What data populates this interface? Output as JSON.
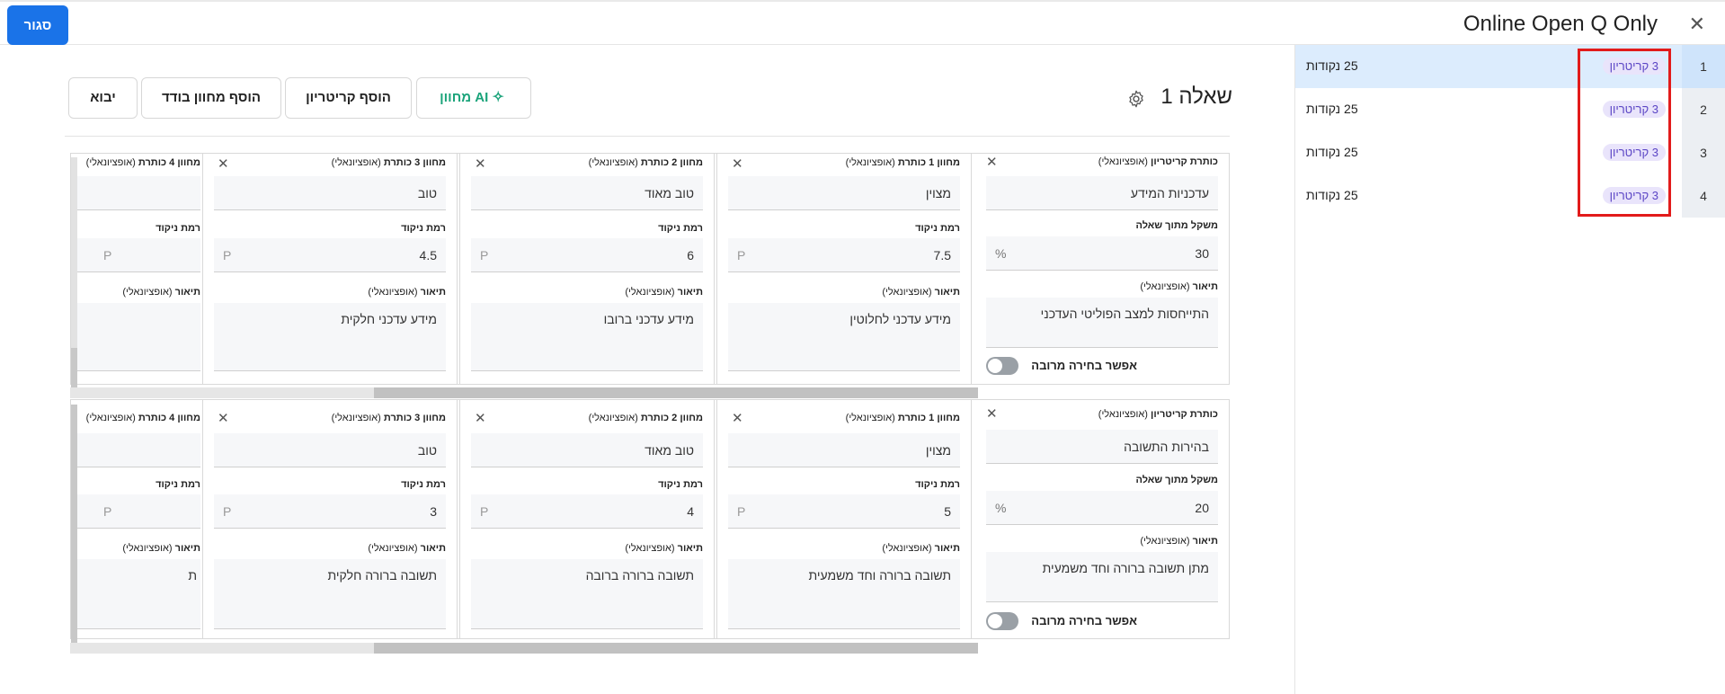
{
  "header": {
    "close_label": "סגור",
    "title": "Online Open Q Only",
    "close_icon": "close-icon"
  },
  "questions": [
    {
      "num": "1",
      "badge": "3 קריטריון",
      "points": "25 נקודות",
      "active": true
    },
    {
      "num": "2",
      "badge": "3 קריטריון",
      "points": "25 נקודות",
      "active": false
    },
    {
      "num": "3",
      "badge": "3 קריטריון",
      "points": "25 נקודות",
      "active": false
    },
    {
      "num": "4",
      "badge": "3 קריטריון",
      "points": "25 נקודות",
      "active": false
    }
  ],
  "main": {
    "question_title": "שאלה 1",
    "buttons": {
      "ai": "מחוון AI",
      "add_criterion": "הוסף קריטריון",
      "add_rubric": "הוסף מחוון בודד",
      "import": "יבוא"
    }
  },
  "labels": {
    "crit_title": "כותרת קריטריון",
    "optional": "(אופציונאלי)",
    "weight": "משקל מתוך שאלה",
    "description": "תיאור",
    "multi": "אפשר בחירה מרובה",
    "score_level": "רמת ניקוד",
    "rubric1": "מחוון 1",
    "rubric2": "מחוון 2",
    "rubric3": "מחוון 3",
    "rubric4": "מחוון 4",
    "heading": "כותרת",
    "p": "P",
    "percent": "%"
  },
  "criteria": [
    {
      "title": "עדכניות המידע",
      "weight": "30",
      "description": "התייחסות למצב הפוליטי העדכני",
      "r1": {
        "title": "מצוין",
        "score": "7.5",
        "desc": "מידע עדכני לחלוטין"
      },
      "r2": {
        "title": "טוב מאוד",
        "score": "6",
        "desc": "מידע עדכני ברובו"
      },
      "r3": {
        "title": "טוב",
        "score": "4.5",
        "desc": "מידע עדכני חלקית"
      },
      "r4": {
        "desc": ""
      }
    },
    {
      "title": "בהירות התשובה",
      "weight": "20",
      "description": "מתן תשובה ברורה וחד משמעית",
      "r1": {
        "title": "מצוין",
        "score": "5",
        "desc": "תשובה ברורה וחד משמעית"
      },
      "r2": {
        "title": "טוב מאוד",
        "score": "4",
        "desc": "תשובה ברורה ברובה"
      },
      "r3": {
        "title": "טוב",
        "score": "3",
        "desc": "תשובה ברורה חלקית"
      },
      "r4": {
        "desc": "ת"
      }
    }
  ]
}
